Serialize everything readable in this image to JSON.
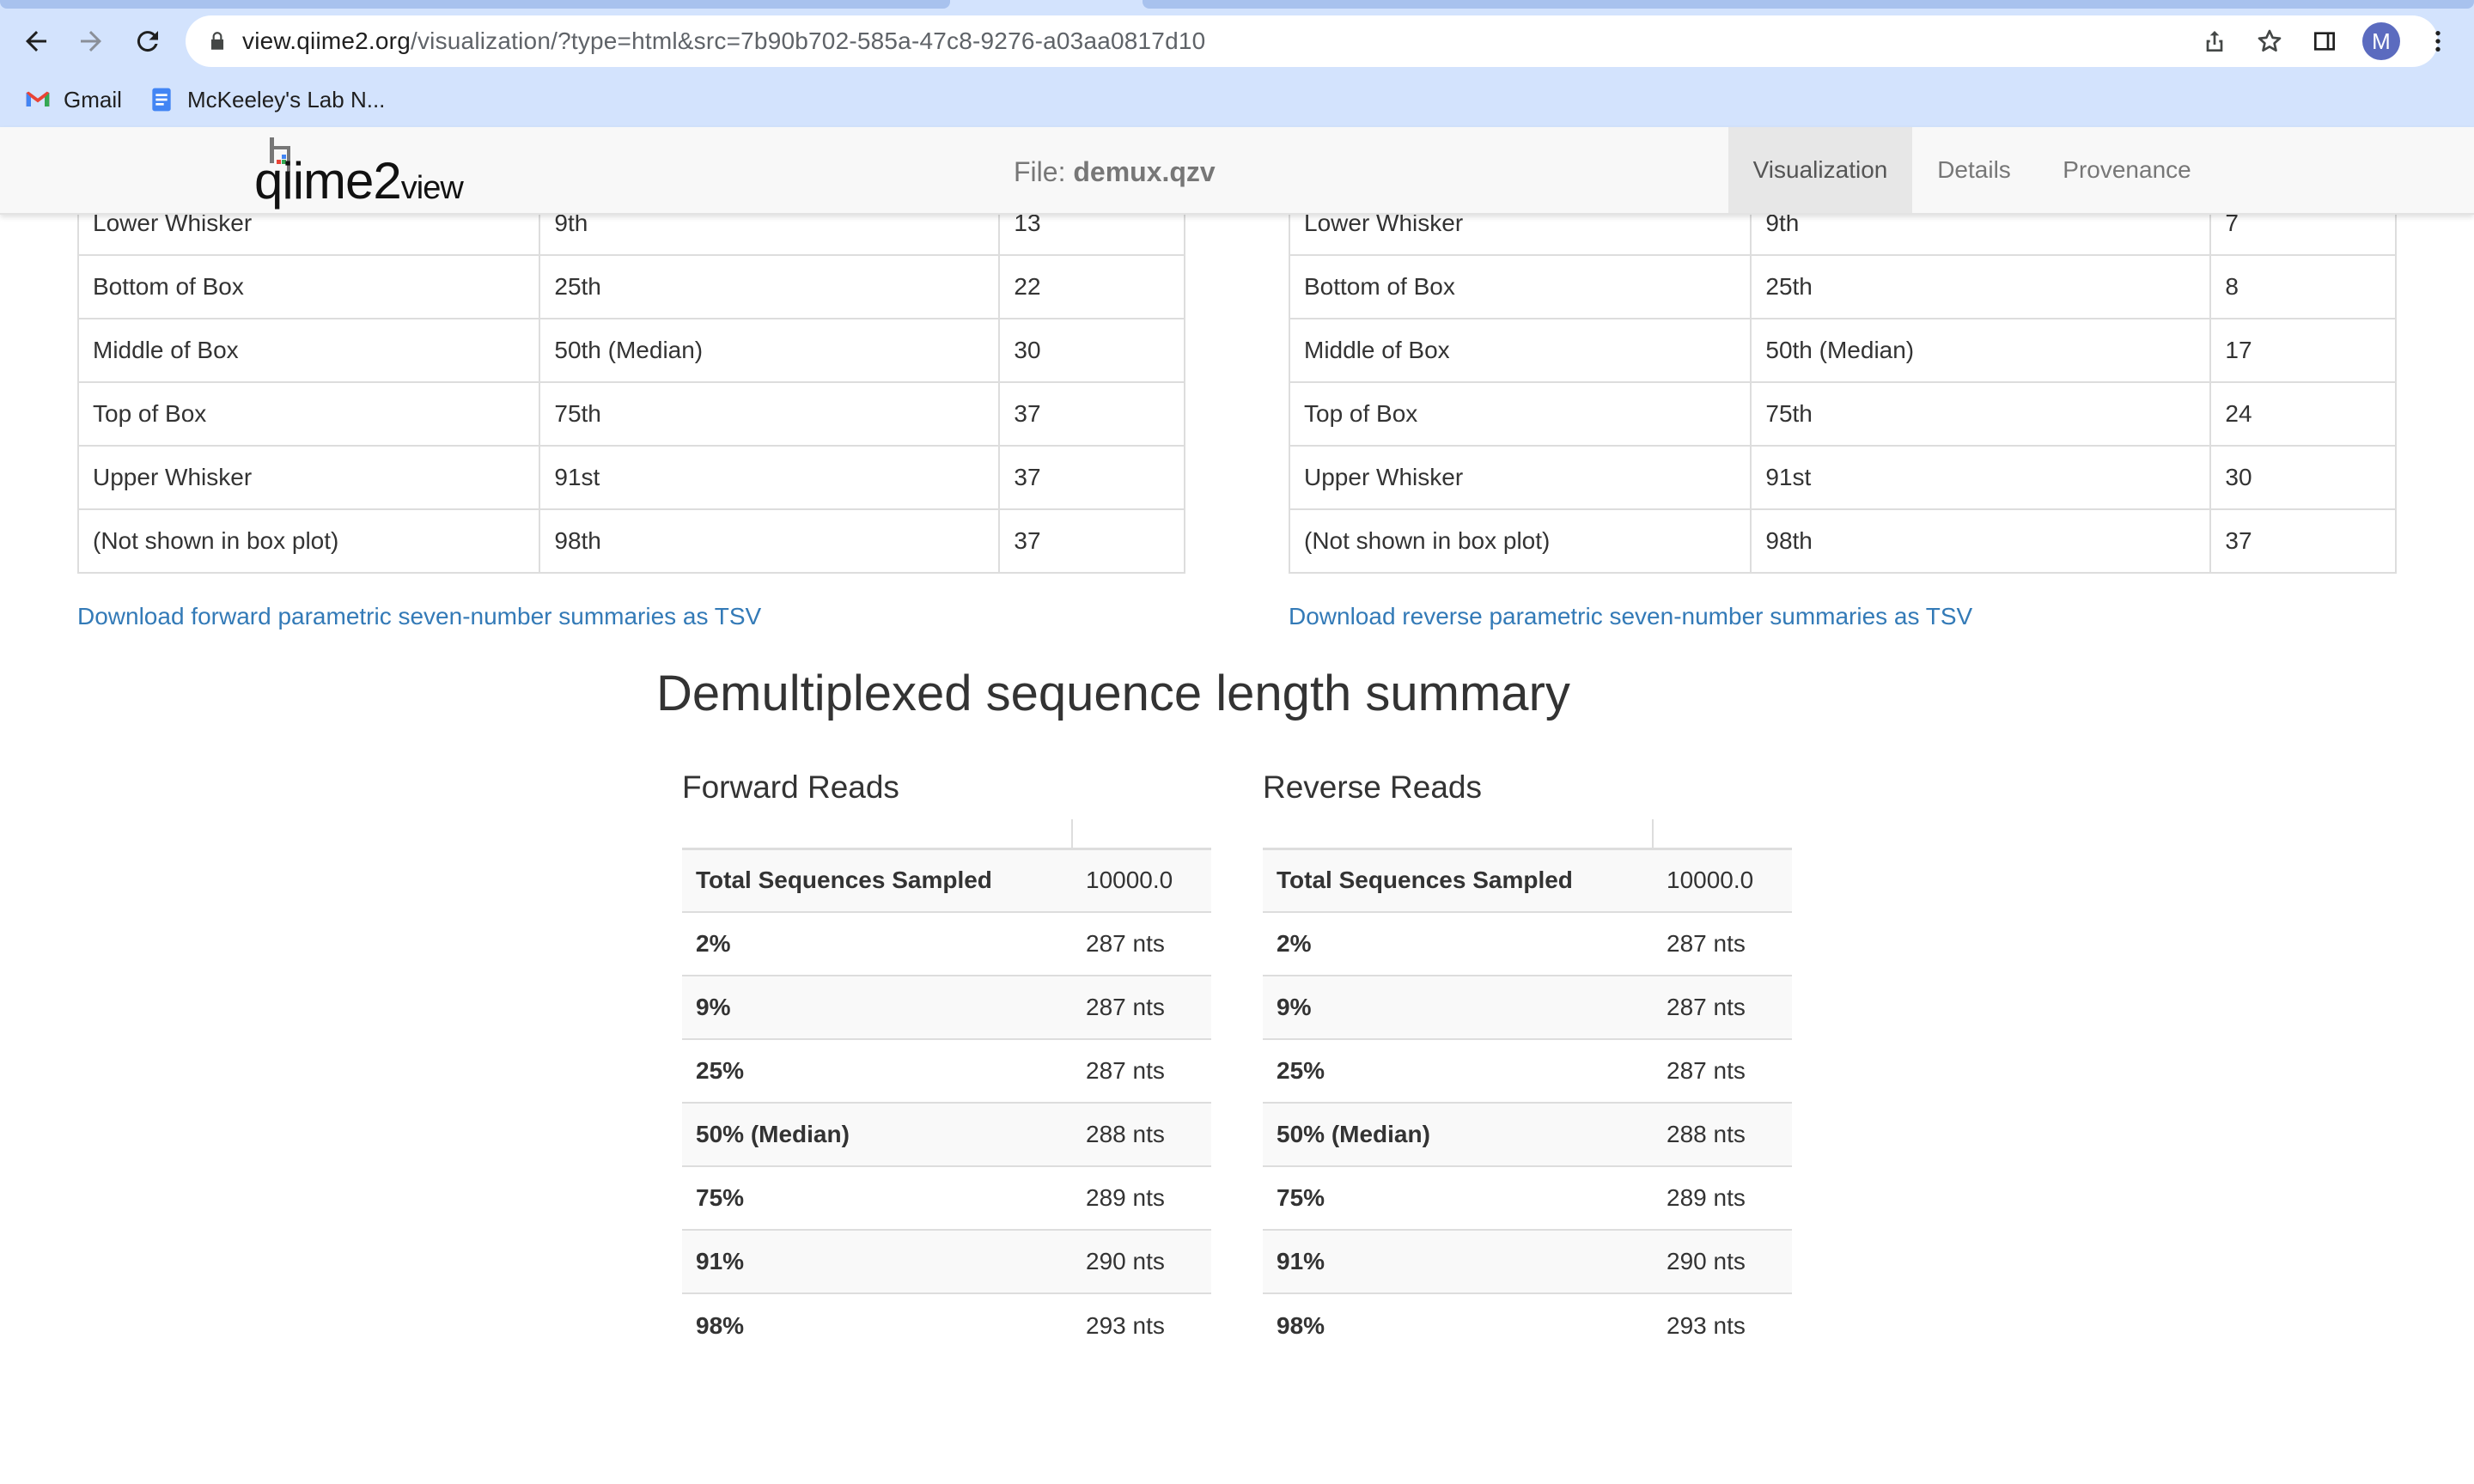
{
  "browser": {
    "url_host": "view.qiime2.org",
    "url_path": "/visualization/?type=html&src=7b90b702-585a-47c8-9276-a03aa0817d10",
    "avatar_letter": "M",
    "bookmarks": [
      {
        "label": "Gmail",
        "icon": "gmail-icon"
      },
      {
        "label": "McKeeley's Lab N...",
        "icon": "google-docs-icon"
      }
    ]
  },
  "header": {
    "logo_main": "qiime2",
    "logo_sub": "view",
    "file_label": "File:",
    "file_name": "demux.qzv",
    "tabs": [
      {
        "label": "Visualization",
        "active": true
      },
      {
        "label": "Details",
        "active": false
      },
      {
        "label": "Provenance",
        "active": false
      }
    ]
  },
  "forward_summary": {
    "rows": [
      [
        "Lower Whisker",
        "9th",
        "13"
      ],
      [
        "Bottom of Box",
        "25th",
        "22"
      ],
      [
        "Middle of Box",
        "50th (Median)",
        "30"
      ],
      [
        "Top of Box",
        "75th",
        "37"
      ],
      [
        "Upper Whisker",
        "91st",
        "37"
      ],
      [
        "(Not shown in box plot)",
        "98th",
        "37"
      ]
    ],
    "download_link": "Download forward parametric seven-number summaries as TSV"
  },
  "reverse_summary": {
    "rows": [
      [
        "Lower Whisker",
        "9th",
        "7"
      ],
      [
        "Bottom of Box",
        "25th",
        "8"
      ],
      [
        "Middle of Box",
        "50th (Median)",
        "17"
      ],
      [
        "Top of Box",
        "75th",
        "24"
      ],
      [
        "Upper Whisker",
        "91st",
        "30"
      ],
      [
        "(Not shown in box plot)",
        "98th",
        "37"
      ]
    ],
    "download_link": "Download reverse parametric seven-number summaries as TSV"
  },
  "length_summary": {
    "title": "Demultiplexed sequence length summary",
    "forward": {
      "title": "Forward Reads",
      "rows": [
        [
          "Total Sequences Sampled",
          "10000.0"
        ],
        [
          "2%",
          "287 nts"
        ],
        [
          "9%",
          "287 nts"
        ],
        [
          "25%",
          "287 nts"
        ],
        [
          "50% (Median)",
          "288 nts"
        ],
        [
          "75%",
          "289 nts"
        ],
        [
          "91%",
          "290 nts"
        ],
        [
          "98%",
          "293 nts"
        ]
      ]
    },
    "reverse": {
      "title": "Reverse Reads",
      "rows": [
        [
          "Total Sequences Sampled",
          "10000.0"
        ],
        [
          "2%",
          "287 nts"
        ],
        [
          "9%",
          "287 nts"
        ],
        [
          "25%",
          "287 nts"
        ],
        [
          "50% (Median)",
          "288 nts"
        ],
        [
          "75%",
          "289 nts"
        ],
        [
          "91%",
          "290 nts"
        ],
        [
          "98%",
          "293 nts"
        ]
      ]
    }
  },
  "colors": {
    "chrome_bg": "#d3e3fd",
    "link": "#337ab7",
    "header_bg": "#f8f8f8",
    "active_tab_bg": "#e7e7e7"
  }
}
